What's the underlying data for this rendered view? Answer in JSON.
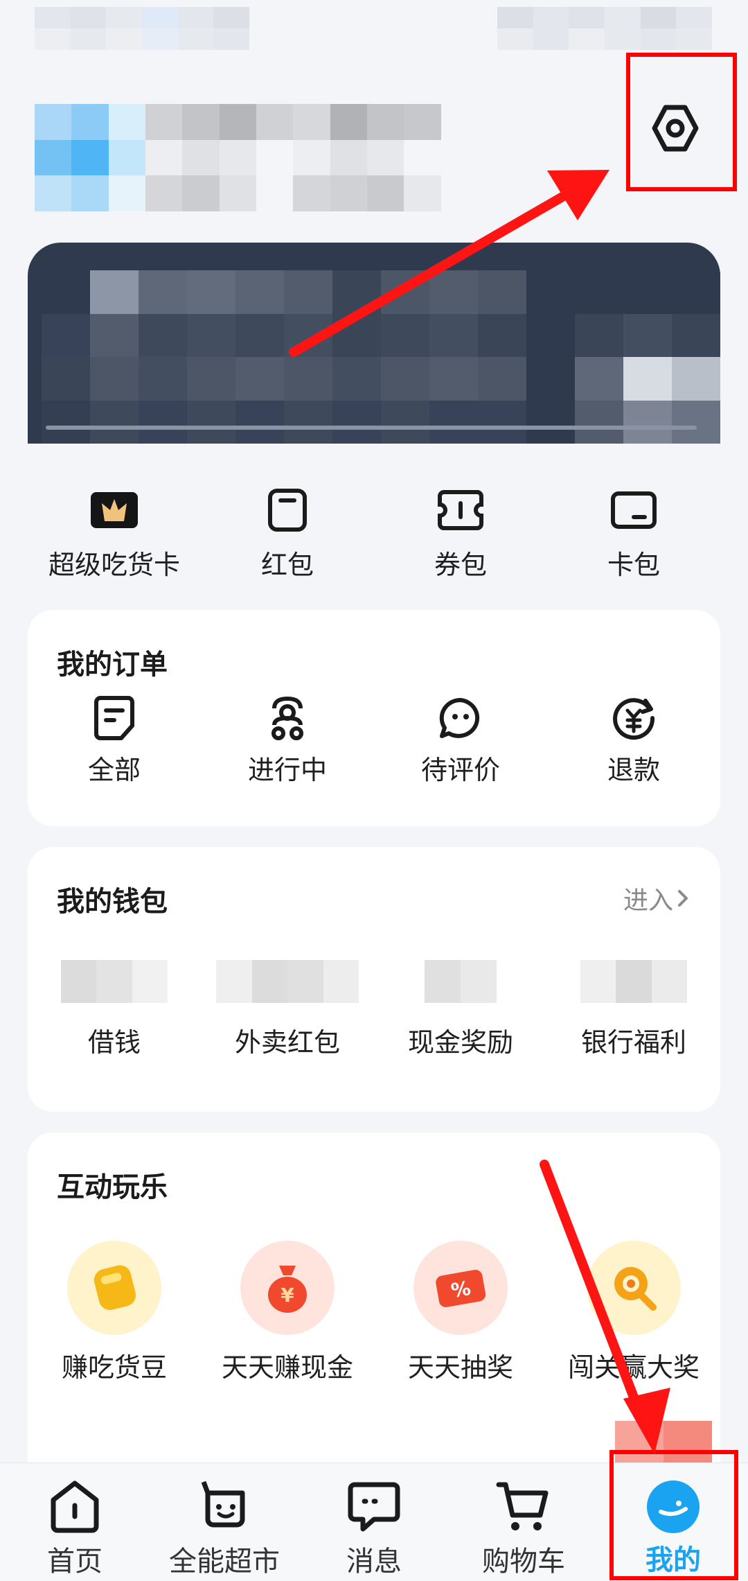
{
  "quick_actions": [
    {
      "icon": "super-foodie-card-icon",
      "label": "超级吃货卡"
    },
    {
      "icon": "red-packet-icon",
      "label": "红包"
    },
    {
      "icon": "coupon-icon",
      "label": "券包"
    },
    {
      "icon": "card-wallet-icon",
      "label": "卡包"
    }
  ],
  "orders": {
    "title": "我的订单",
    "items": [
      {
        "icon": "all-orders-icon",
        "label": "全部"
      },
      {
        "icon": "rider-icon",
        "label": "进行中"
      },
      {
        "icon": "comment-icon",
        "label": "待评价"
      },
      {
        "icon": "refund-icon",
        "label": "退款"
      }
    ]
  },
  "wallet": {
    "title": "我的钱包",
    "enter_label": "进入",
    "items": [
      {
        "label": "借钱"
      },
      {
        "label": "外卖红包"
      },
      {
        "label": "现金奖励"
      },
      {
        "label": "银行福利"
      }
    ]
  },
  "fun": {
    "title": "互动玩乐",
    "items": [
      {
        "icon": "bean-icon",
        "label": "赚吃货豆",
        "color": "#f5b816"
      },
      {
        "icon": "money-bag-icon",
        "label": "天天赚现金",
        "color": "#f0492e"
      },
      {
        "icon": "lottery-ticket-icon",
        "label": "天天抽奖",
        "color": "#f0492e"
      },
      {
        "icon": "magnifier-prize-icon",
        "label": "闯关赢大奖",
        "color": "#f5a316"
      }
    ]
  },
  "tabbar": [
    {
      "icon": "home-icon",
      "label": "首页"
    },
    {
      "icon": "supermarket-icon",
      "label": "全能超市"
    },
    {
      "icon": "message-icon",
      "label": "消息"
    },
    {
      "icon": "cart-icon",
      "label": "购物车"
    },
    {
      "icon": "profile-icon",
      "label": "我的"
    }
  ],
  "colors": {
    "accent": "#1aa3f0",
    "annotation": "#ff0000",
    "member_card_bg": "#2f3a4e"
  }
}
